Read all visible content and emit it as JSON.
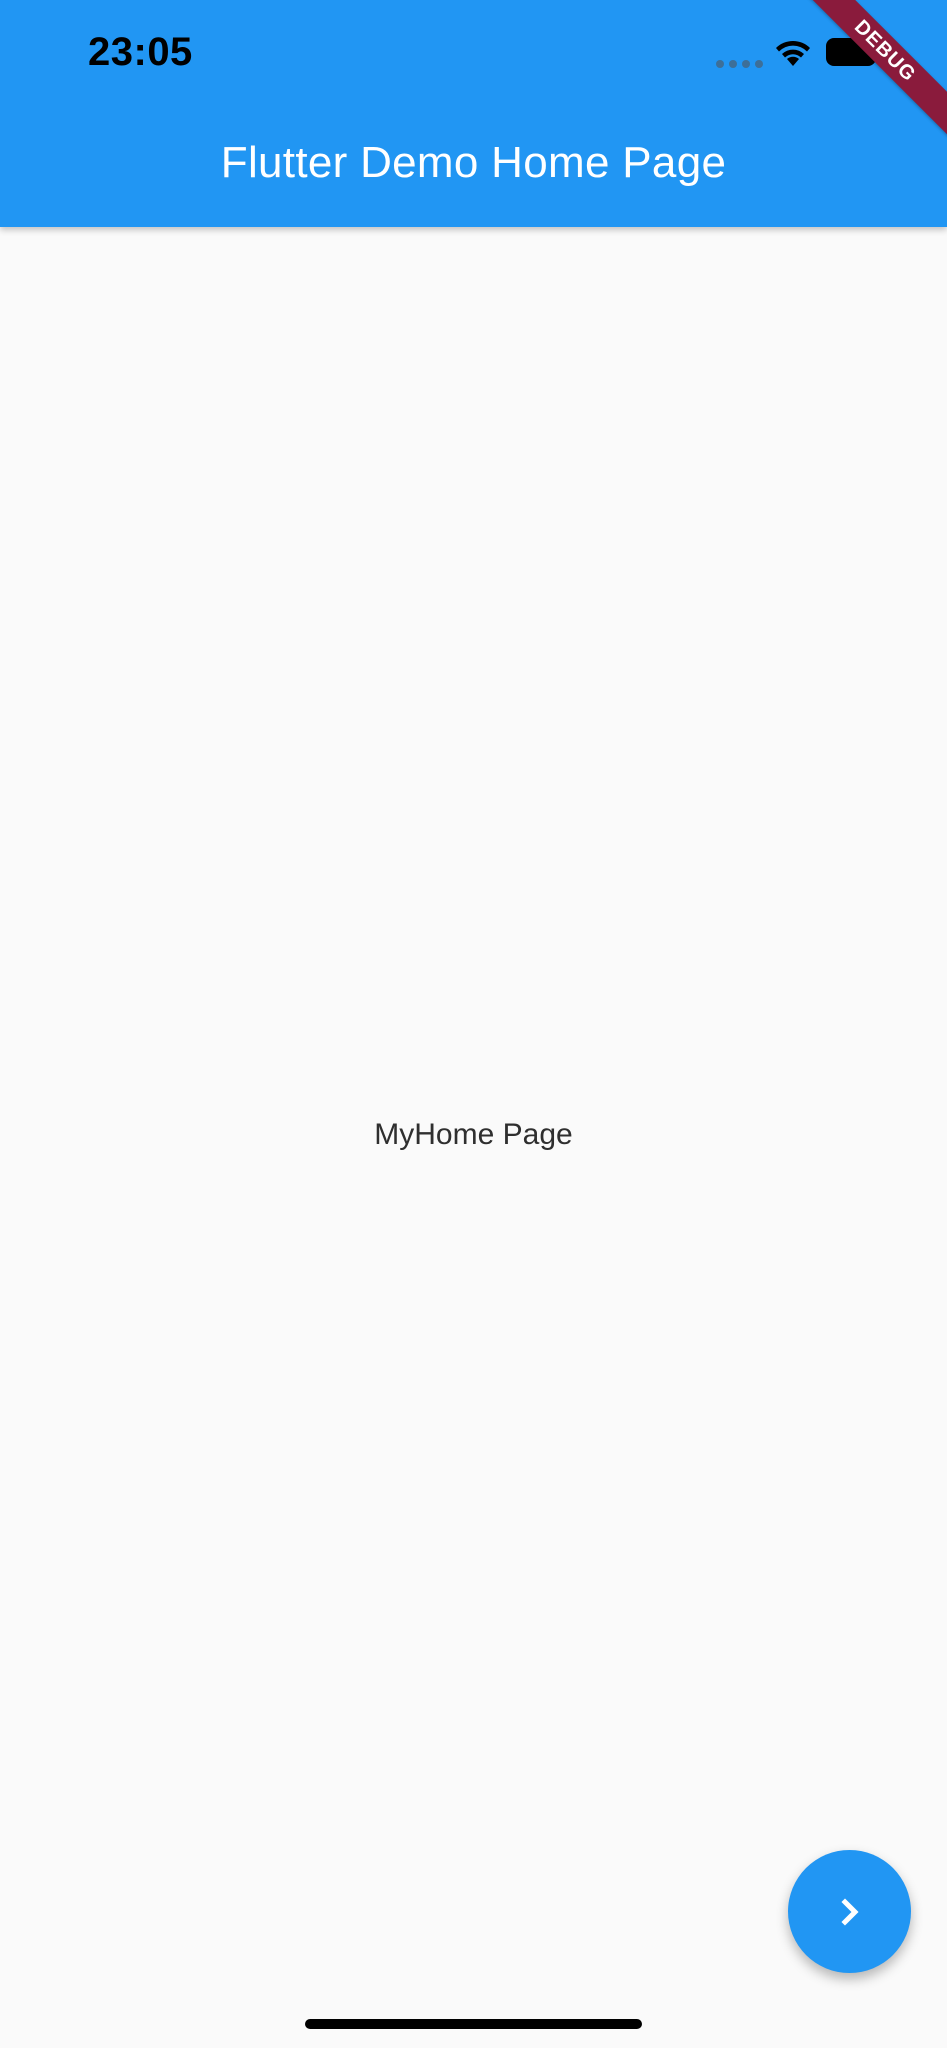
{
  "status_bar": {
    "time": "23:05"
  },
  "debug_banner": {
    "label": "DEBUG"
  },
  "app_bar": {
    "title": "Flutter Demo Home Page"
  },
  "body": {
    "text": "MyHome Page"
  },
  "fab": {
    "icon": "chevron-right-icon"
  },
  "colors": {
    "primary": "#2196F3",
    "background": "#FAFAFA",
    "debug_banner": "#8A1B3C"
  }
}
